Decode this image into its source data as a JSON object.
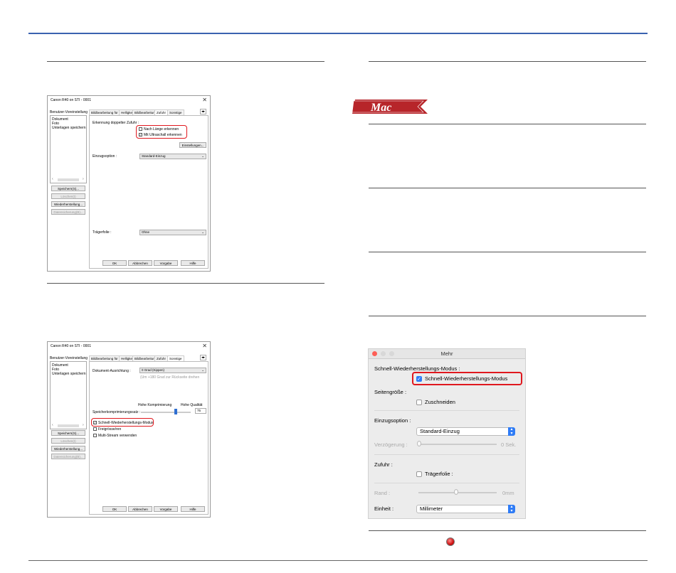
{
  "win1": {
    "title": "Canon R40 on STI - 0001",
    "close": "✕",
    "left_tab": "Benutzer-Voreinstellung",
    "list_items": [
      "Dokument",
      "Foto",
      "Unterlagen speichern"
    ],
    "tabs": [
      "Bildbearbeitung für Fotos",
      "Helligkeit",
      "Bildbearbeitung",
      "Zufuhr",
      "Sonstige"
    ],
    "feed_double_label": "Erkennung doppelter Zufuhr :",
    "cb_length": "Nach Länge erkennen",
    "cb_ultrasonic": "Mit Ultraschall erkennen",
    "settings_btn": "Einstellungen...",
    "feed_option_label": "Einzugsoption :",
    "feed_option_value": "Standard-Einzug",
    "carrier_label": "Trägerfolie :",
    "carrier_value": "Ohne",
    "left_buttons": [
      "Speichern(S)...",
      "Löschen(I)",
      "Wiederherstellung...",
      "Datensicherung(B)..."
    ],
    "bottom_buttons": [
      "OK",
      "Abbrechen",
      "Vorgabe",
      "Hilfe"
    ]
  },
  "win2": {
    "title": "Canon R40 on STI - 0001",
    "close": "✕",
    "left_tab": "Benutzer-Voreinstellung",
    "list_items": [
      "Dokument",
      "Foto",
      "Unterlagen speichern"
    ],
    "tabs": [
      "Bildbearbeitung für Fotos",
      "Helligkeit",
      "Bildbearbeitung",
      "Zufuhr",
      "Sonstige"
    ],
    "orientation_label": "Dokument-Ausrichtung :",
    "orientation_value": "0 Grad (Kippen)",
    "orientation_note": "(Um +180 Grad zur Rückseite drehen",
    "slider_left": "Hohe Komprimierung",
    "slider_right": "Hohe Qualität",
    "memory_label": "Speicherkomprimierungssatz :",
    "memory_value": "75",
    "cb_quick": "Schnell-Wiederherstellungs-Modus",
    "cb_crop": "Freigrösse/ren",
    "cb_multi": "Multi-Stream verwenden",
    "left_buttons": [
      "Speichern(S)...",
      "Löschen(I)",
      "Wiederherstellung...",
      "Datensicherung(B)..."
    ],
    "bottom_buttons": [
      "OK",
      "Abbrechen",
      "Vorgabe",
      "Hilfe"
    ]
  },
  "mac_badge": "Mac",
  "mac": {
    "title": "Mehr",
    "quick_section": "Schnell-Wiederherstellungs-Modus :",
    "quick_cb": "Schnell-Wiederherstellungs-Modus",
    "size_section": "Seitengröße :",
    "crop_cb": "Zuschneiden",
    "feed_section": "Einzugsoption :",
    "feed_value": "Standard-Einzug",
    "delay_label": "Verzögerung :",
    "delay_value": "0 Sek.",
    "supply_section": "Zufuhr :",
    "carrier_cb": "Trägerfolie :",
    "edge_label": "Rand :",
    "edge_value": "0mm",
    "unit_label": "Einheit :",
    "unit_value": "Millimeter"
  },
  "colors": {
    "accent": "#3a62b0",
    "highlight": "#e0181e",
    "mac_badge": "#b7252a",
    "mac_blue": "#2f7cf6"
  }
}
